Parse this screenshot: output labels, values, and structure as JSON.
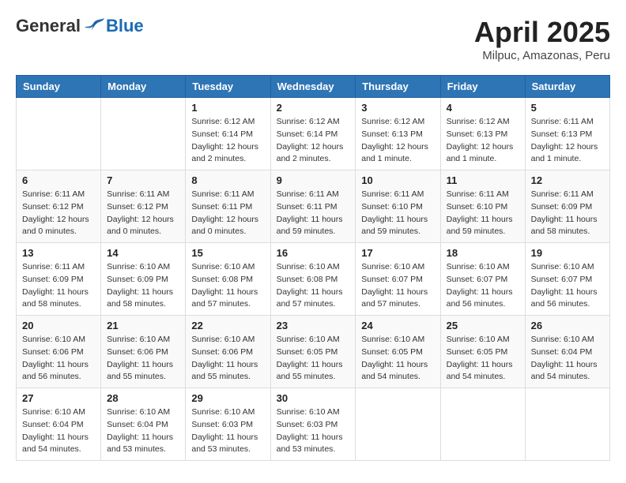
{
  "logo": {
    "general": "General",
    "blue": "Blue"
  },
  "header": {
    "month": "April 2025",
    "location": "Milpuc, Amazonas, Peru"
  },
  "weekdays": [
    "Sunday",
    "Monday",
    "Tuesday",
    "Wednesday",
    "Thursday",
    "Friday",
    "Saturday"
  ],
  "weeks": [
    [
      {
        "day": "",
        "info": ""
      },
      {
        "day": "",
        "info": ""
      },
      {
        "day": "1",
        "info": "Sunrise: 6:12 AM\nSunset: 6:14 PM\nDaylight: 12 hours and 2 minutes."
      },
      {
        "day": "2",
        "info": "Sunrise: 6:12 AM\nSunset: 6:14 PM\nDaylight: 12 hours and 2 minutes."
      },
      {
        "day": "3",
        "info": "Sunrise: 6:12 AM\nSunset: 6:13 PM\nDaylight: 12 hours and 1 minute."
      },
      {
        "day": "4",
        "info": "Sunrise: 6:12 AM\nSunset: 6:13 PM\nDaylight: 12 hours and 1 minute."
      },
      {
        "day": "5",
        "info": "Sunrise: 6:11 AM\nSunset: 6:13 PM\nDaylight: 12 hours and 1 minute."
      }
    ],
    [
      {
        "day": "6",
        "info": "Sunrise: 6:11 AM\nSunset: 6:12 PM\nDaylight: 12 hours and 0 minutes."
      },
      {
        "day": "7",
        "info": "Sunrise: 6:11 AM\nSunset: 6:12 PM\nDaylight: 12 hours and 0 minutes."
      },
      {
        "day": "8",
        "info": "Sunrise: 6:11 AM\nSunset: 6:11 PM\nDaylight: 12 hours and 0 minutes."
      },
      {
        "day": "9",
        "info": "Sunrise: 6:11 AM\nSunset: 6:11 PM\nDaylight: 11 hours and 59 minutes."
      },
      {
        "day": "10",
        "info": "Sunrise: 6:11 AM\nSunset: 6:10 PM\nDaylight: 11 hours and 59 minutes."
      },
      {
        "day": "11",
        "info": "Sunrise: 6:11 AM\nSunset: 6:10 PM\nDaylight: 11 hours and 59 minutes."
      },
      {
        "day": "12",
        "info": "Sunrise: 6:11 AM\nSunset: 6:09 PM\nDaylight: 11 hours and 58 minutes."
      }
    ],
    [
      {
        "day": "13",
        "info": "Sunrise: 6:11 AM\nSunset: 6:09 PM\nDaylight: 11 hours and 58 minutes."
      },
      {
        "day": "14",
        "info": "Sunrise: 6:10 AM\nSunset: 6:09 PM\nDaylight: 11 hours and 58 minutes."
      },
      {
        "day": "15",
        "info": "Sunrise: 6:10 AM\nSunset: 6:08 PM\nDaylight: 11 hours and 57 minutes."
      },
      {
        "day": "16",
        "info": "Sunrise: 6:10 AM\nSunset: 6:08 PM\nDaylight: 11 hours and 57 minutes."
      },
      {
        "day": "17",
        "info": "Sunrise: 6:10 AM\nSunset: 6:07 PM\nDaylight: 11 hours and 57 minutes."
      },
      {
        "day": "18",
        "info": "Sunrise: 6:10 AM\nSunset: 6:07 PM\nDaylight: 11 hours and 56 minutes."
      },
      {
        "day": "19",
        "info": "Sunrise: 6:10 AM\nSunset: 6:07 PM\nDaylight: 11 hours and 56 minutes."
      }
    ],
    [
      {
        "day": "20",
        "info": "Sunrise: 6:10 AM\nSunset: 6:06 PM\nDaylight: 11 hours and 56 minutes."
      },
      {
        "day": "21",
        "info": "Sunrise: 6:10 AM\nSunset: 6:06 PM\nDaylight: 11 hours and 55 minutes."
      },
      {
        "day": "22",
        "info": "Sunrise: 6:10 AM\nSunset: 6:06 PM\nDaylight: 11 hours and 55 minutes."
      },
      {
        "day": "23",
        "info": "Sunrise: 6:10 AM\nSunset: 6:05 PM\nDaylight: 11 hours and 55 minutes."
      },
      {
        "day": "24",
        "info": "Sunrise: 6:10 AM\nSunset: 6:05 PM\nDaylight: 11 hours and 54 minutes."
      },
      {
        "day": "25",
        "info": "Sunrise: 6:10 AM\nSunset: 6:05 PM\nDaylight: 11 hours and 54 minutes."
      },
      {
        "day": "26",
        "info": "Sunrise: 6:10 AM\nSunset: 6:04 PM\nDaylight: 11 hours and 54 minutes."
      }
    ],
    [
      {
        "day": "27",
        "info": "Sunrise: 6:10 AM\nSunset: 6:04 PM\nDaylight: 11 hours and 54 minutes."
      },
      {
        "day": "28",
        "info": "Sunrise: 6:10 AM\nSunset: 6:04 PM\nDaylight: 11 hours and 53 minutes."
      },
      {
        "day": "29",
        "info": "Sunrise: 6:10 AM\nSunset: 6:03 PM\nDaylight: 11 hours and 53 minutes."
      },
      {
        "day": "30",
        "info": "Sunrise: 6:10 AM\nSunset: 6:03 PM\nDaylight: 11 hours and 53 minutes."
      },
      {
        "day": "",
        "info": ""
      },
      {
        "day": "",
        "info": ""
      },
      {
        "day": "",
        "info": ""
      }
    ]
  ]
}
